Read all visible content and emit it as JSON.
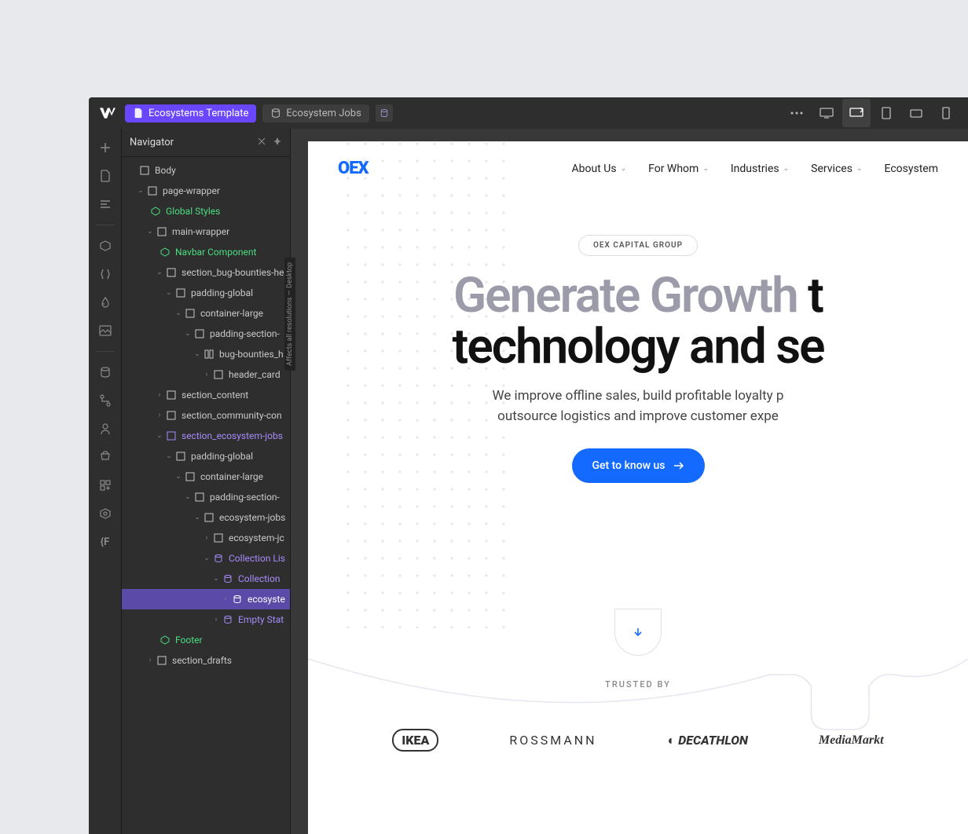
{
  "topbar": {
    "tab_active": "Ecosystems Template",
    "tab_inactive": "Ecosystem Jobs"
  },
  "navigator": {
    "title": "Navigator"
  },
  "tree": {
    "body": "Body",
    "page_wrapper": "page-wrapper",
    "global_styles": "Global Styles",
    "main_wrapper": "main-wrapper",
    "navbar_component": "Navbar Component",
    "section_bug": "section_bug-bounties-he",
    "padding_global_1": "padding-global",
    "container_large_1": "container-large",
    "padding_section_1": "padding-section-",
    "bug_bounties_h": "bug-bounties_h",
    "header_card": "header_card",
    "section_content": "section_content",
    "section_community": "section_community-con",
    "section_ecosystem_jobs": "section_ecosystem-jobs",
    "padding_global_2": "padding-global",
    "container_large_2": "container-large",
    "padding_section_2": "padding-section-",
    "ecosystem_jobs": "ecosystem-jobs",
    "ecosystem_jc": "ecosystem-jc",
    "collection_list": "Collection Lis",
    "collection": "Collection",
    "ecosyste": "ecosyste",
    "empty_state": "Empty Stat",
    "footer": "Footer",
    "section_drafts": "section_drafts"
  },
  "site": {
    "logo": "OEX",
    "nav": {
      "about": "About Us",
      "forwhom": "For Whom",
      "industries": "Industries",
      "services": "Services",
      "ecosystem": "Ecosystem"
    },
    "badge": "OEX CAPITAL GROUP",
    "hero_line1_muted": "Generate Growth",
    "hero_line1_rest": " t",
    "hero_line2": "technology and se",
    "sub_line1": "We improve offline sales, build profitable loyalty p",
    "sub_line2": "outsource logistics and improve customer expe",
    "cta": "Get to know us",
    "trusted": "TRUSTED BY",
    "brands": {
      "ikea": "IKEA",
      "rossmann": "ROSSMANN",
      "decathlon": "DECATHLON",
      "mediamarkt": "MediaMarkt"
    }
  },
  "sidetab": "Affects all resolutions — Desktop"
}
